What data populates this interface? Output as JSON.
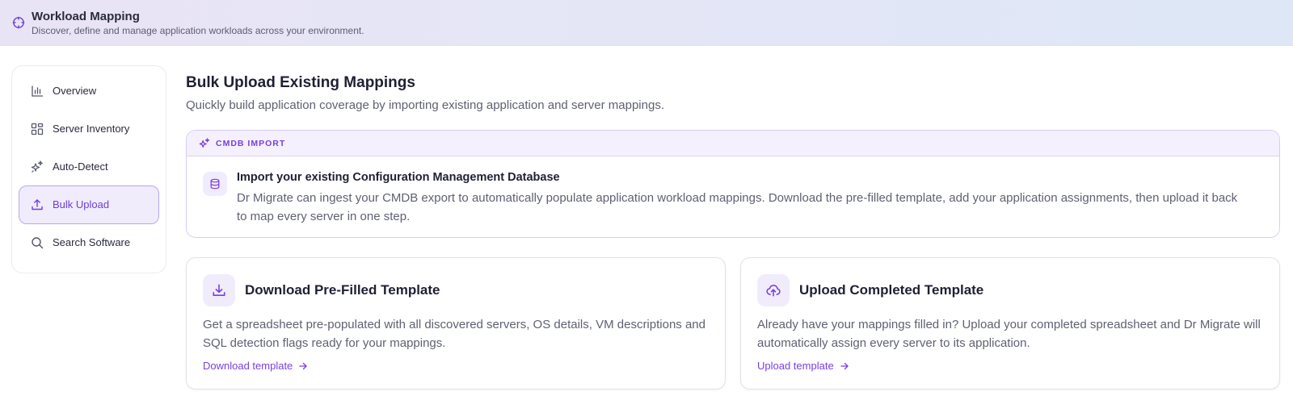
{
  "header": {
    "title": "Workload Mapping",
    "subtitle": "Discover, define and manage application workloads across your environment.",
    "icon": "crosshair-icon"
  },
  "sidebar": {
    "items": [
      {
        "label": "Overview",
        "icon": "bar-chart-icon",
        "active": false
      },
      {
        "label": "Server Inventory",
        "icon": "grid-icon",
        "active": false
      },
      {
        "label": "Auto-Detect",
        "icon": "sparkles-icon",
        "active": false
      },
      {
        "label": "Bulk Upload",
        "icon": "upload-icon",
        "active": true
      },
      {
        "label": "Search Software",
        "icon": "search-icon",
        "active": false
      }
    ]
  },
  "main": {
    "title": "Bulk Upload Existing Mappings",
    "subtitle": "Quickly build application coverage by importing existing application and server mappings.",
    "cmdb": {
      "badge": "CMDB IMPORT",
      "title": "Import your existing Configuration Management Database",
      "description": "Dr Migrate can ingest your CMDB export to automatically populate application workload mappings. Download the pre-filled template, add your application assignments, then upload it back to map every server in one step."
    },
    "cards": [
      {
        "icon": "download-icon",
        "title": "Download Pre-Filled Template",
        "description": "Get a spreadsheet pre-populated with all discovered servers, OS details, VM descriptions and SQL detection flags ready for your mappings.",
        "link": "Download template"
      },
      {
        "icon": "cloud-upload-icon",
        "title": "Upload Completed Template",
        "description": "Already have your mappings filled in? Upload your completed spreadsheet and Dr Migrate will automatically assign every server to its application.",
        "link": "Upload template"
      }
    ]
  },
  "colors": {
    "accent": "#7a3fe0",
    "active_bg": "#f0ecfb",
    "active_border": "#b9a8ee",
    "header_bg_start": "#e9e4f5",
    "header_bg_end": "#dde7f6"
  }
}
